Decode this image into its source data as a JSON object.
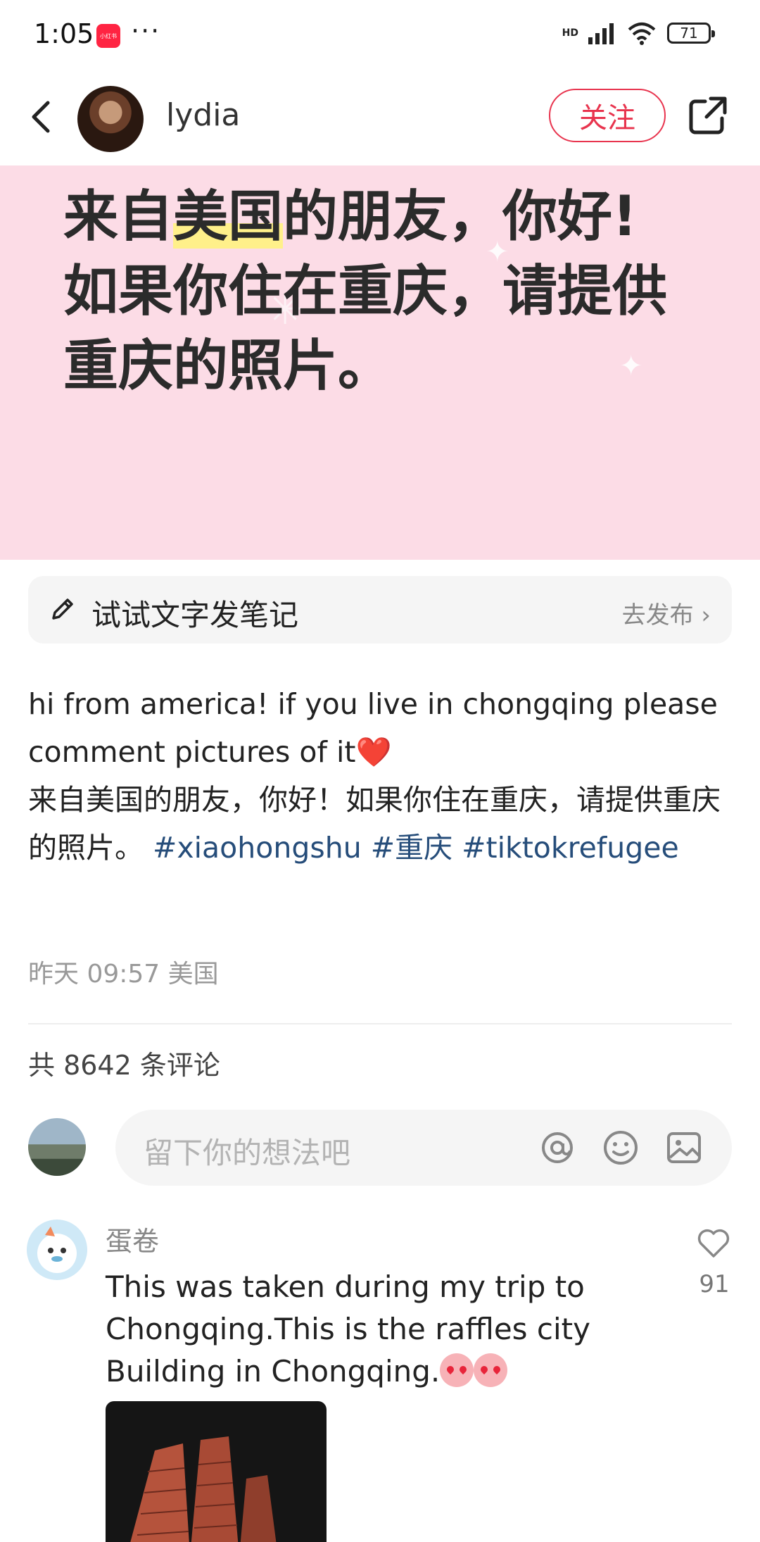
{
  "status_bar": {
    "time": "1:05",
    "app_icon_text": "小红书",
    "more": "···",
    "network": "HD",
    "battery": "71"
  },
  "header": {
    "username": "lydia",
    "follow_label": "关注"
  },
  "banner": {
    "line1_pre": "来自",
    "line1_hl": "美国",
    "line1_post": "的朋友，你好!",
    "line2": "如果你住在重庆，请提供",
    "line3": "重庆的照片。"
  },
  "write_note": {
    "label": "试试文字发笔记",
    "publish": "去发布 ›"
  },
  "post": {
    "caption_en": "hi from america! if you live in chongqing please comment pictures of it",
    "heart": "❤️",
    "caption_zh": "来自美国的朋友，你好！如果你住在重庆，请提供重庆的照片。",
    "tags": [
      "#xiaohongshu",
      "#重庆",
      "#tiktokrefugee"
    ],
    "meta": "昨天 09:57 美国",
    "comment_count": "共 8642 条评论"
  },
  "comment_input": {
    "placeholder": "留下你的想法吧"
  },
  "comments": [
    {
      "author": "蛋卷",
      "text": "This was taken during my trip to Chongqing.This is the raffles city Building in Chongqing.",
      "likes": "91"
    }
  ]
}
